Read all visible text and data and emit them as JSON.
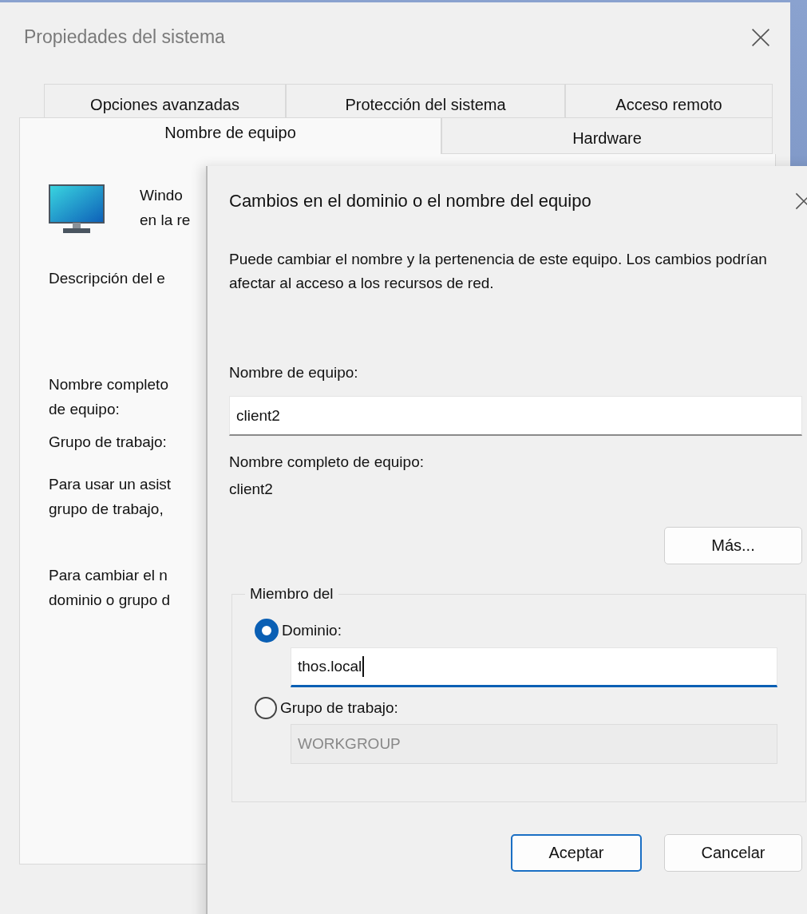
{
  "background_window": {
    "title": "Propiedades del sistema",
    "tab_rows": [
      [
        {
          "label": "Opciones avanzadas",
          "selected": false
        },
        {
          "label": "Protección del sistema",
          "selected": false
        },
        {
          "label": "Acceso remoto",
          "selected": false
        }
      ],
      [
        {
          "label": "Nombre de equipo",
          "selected": true
        },
        {
          "label": "Hardware",
          "selected": false
        }
      ]
    ],
    "intro": [
      "Windo",
      "en la re"
    ],
    "description_label": [
      "Descripción del e"
    ],
    "full_name_label": [
      "Nombre completo",
      "de equipo:"
    ],
    "workgroup_label": [
      "Grupo de trabajo:"
    ],
    "wizard_text": [
      "Para usar un asist",
      "grupo de trabajo,"
    ],
    "change_text": [
      "Para cambiar el n",
      "dominio o grupo d"
    ]
  },
  "dialog": {
    "title": "Cambios en el dominio o el nombre del equipo",
    "message": "Puede cambiar el nombre y la pertenencia de este equipo. Los cambios podrían afectar al acceso a los recursos de red.",
    "computer_name_label": "Nombre de equipo:",
    "computer_name_value": "client2",
    "full_name_label": "Nombre completo de equipo:",
    "full_name_value": "client2",
    "more_button": "Más...",
    "member_group": {
      "legend": "Miembro del",
      "options": [
        {
          "label": "Dominio:",
          "selected": true,
          "value": "thos.local"
        },
        {
          "label": "Grupo de trabajo:",
          "selected": false,
          "value": "WORKGROUP"
        }
      ]
    },
    "buttons": [
      {
        "label": "Aceptar",
        "default": true
      },
      {
        "label": "Cancelar",
        "default": false
      }
    ]
  }
}
